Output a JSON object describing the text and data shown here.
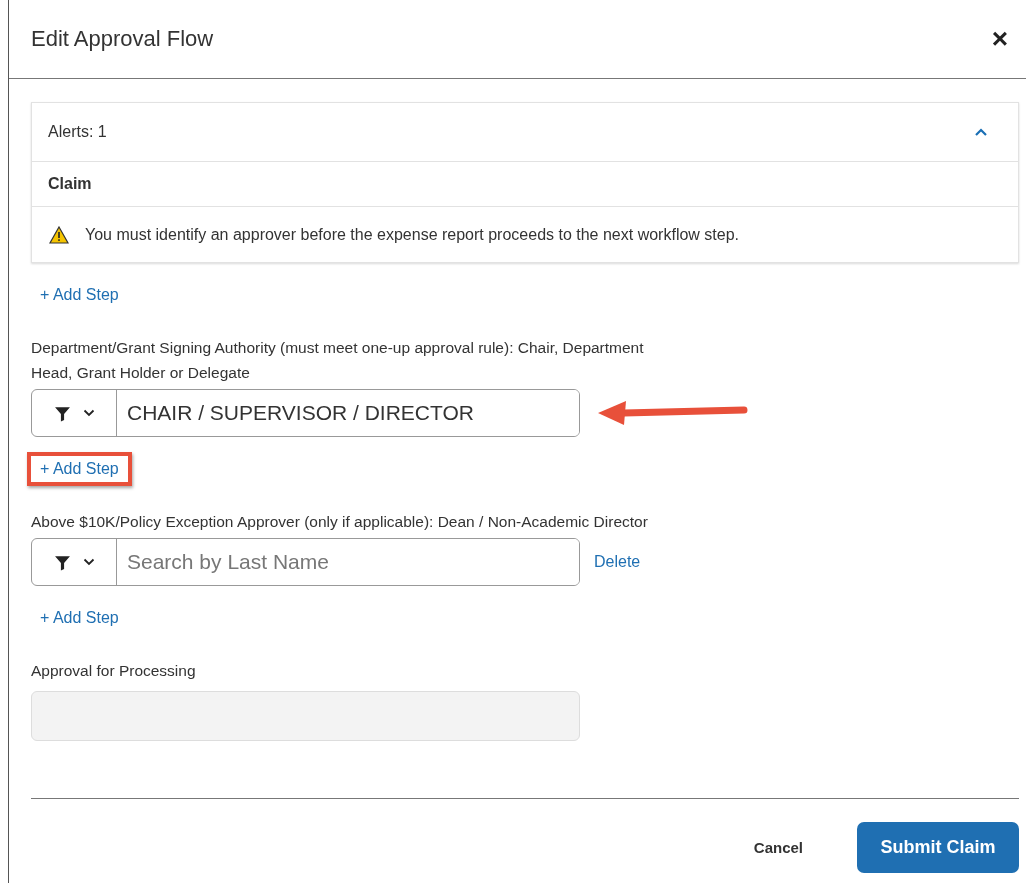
{
  "dialog": {
    "title": "Edit Approval Flow",
    "close": "×"
  },
  "alerts": {
    "label": "Alerts: 1",
    "expanded": true,
    "section": "Claim",
    "messages": [
      "You must identify an approver before the expense report proceeds to the next workflow step."
    ]
  },
  "flow": [
    {
      "kind": "add_step",
      "label": "+ Add Step",
      "highlighted": false
    },
    {
      "kind": "approver",
      "label": "Department/Grant Signing Authority (must meet one-up approval rule): Chair, Department Head, Grant Holder or Delegate",
      "value": "CHAIR / SUPERVISOR / DIRECTOR",
      "arrow": true
    },
    {
      "kind": "add_step",
      "label": "+ Add Step",
      "highlighted": true
    },
    {
      "kind": "approver",
      "label": "Above $10K/Policy Exception Approver (only if applicable): Dean / Non-Academic Director",
      "placeholder": "Search by Last Name",
      "delete": "Delete",
      "arrow": false
    },
    {
      "kind": "add_step",
      "label": "+ Add Step",
      "highlighted": false
    },
    {
      "kind": "readonly",
      "label": "Approval for Processing"
    }
  ],
  "buttons": {
    "cancel": "Cancel",
    "submit": "Submit Claim"
  }
}
